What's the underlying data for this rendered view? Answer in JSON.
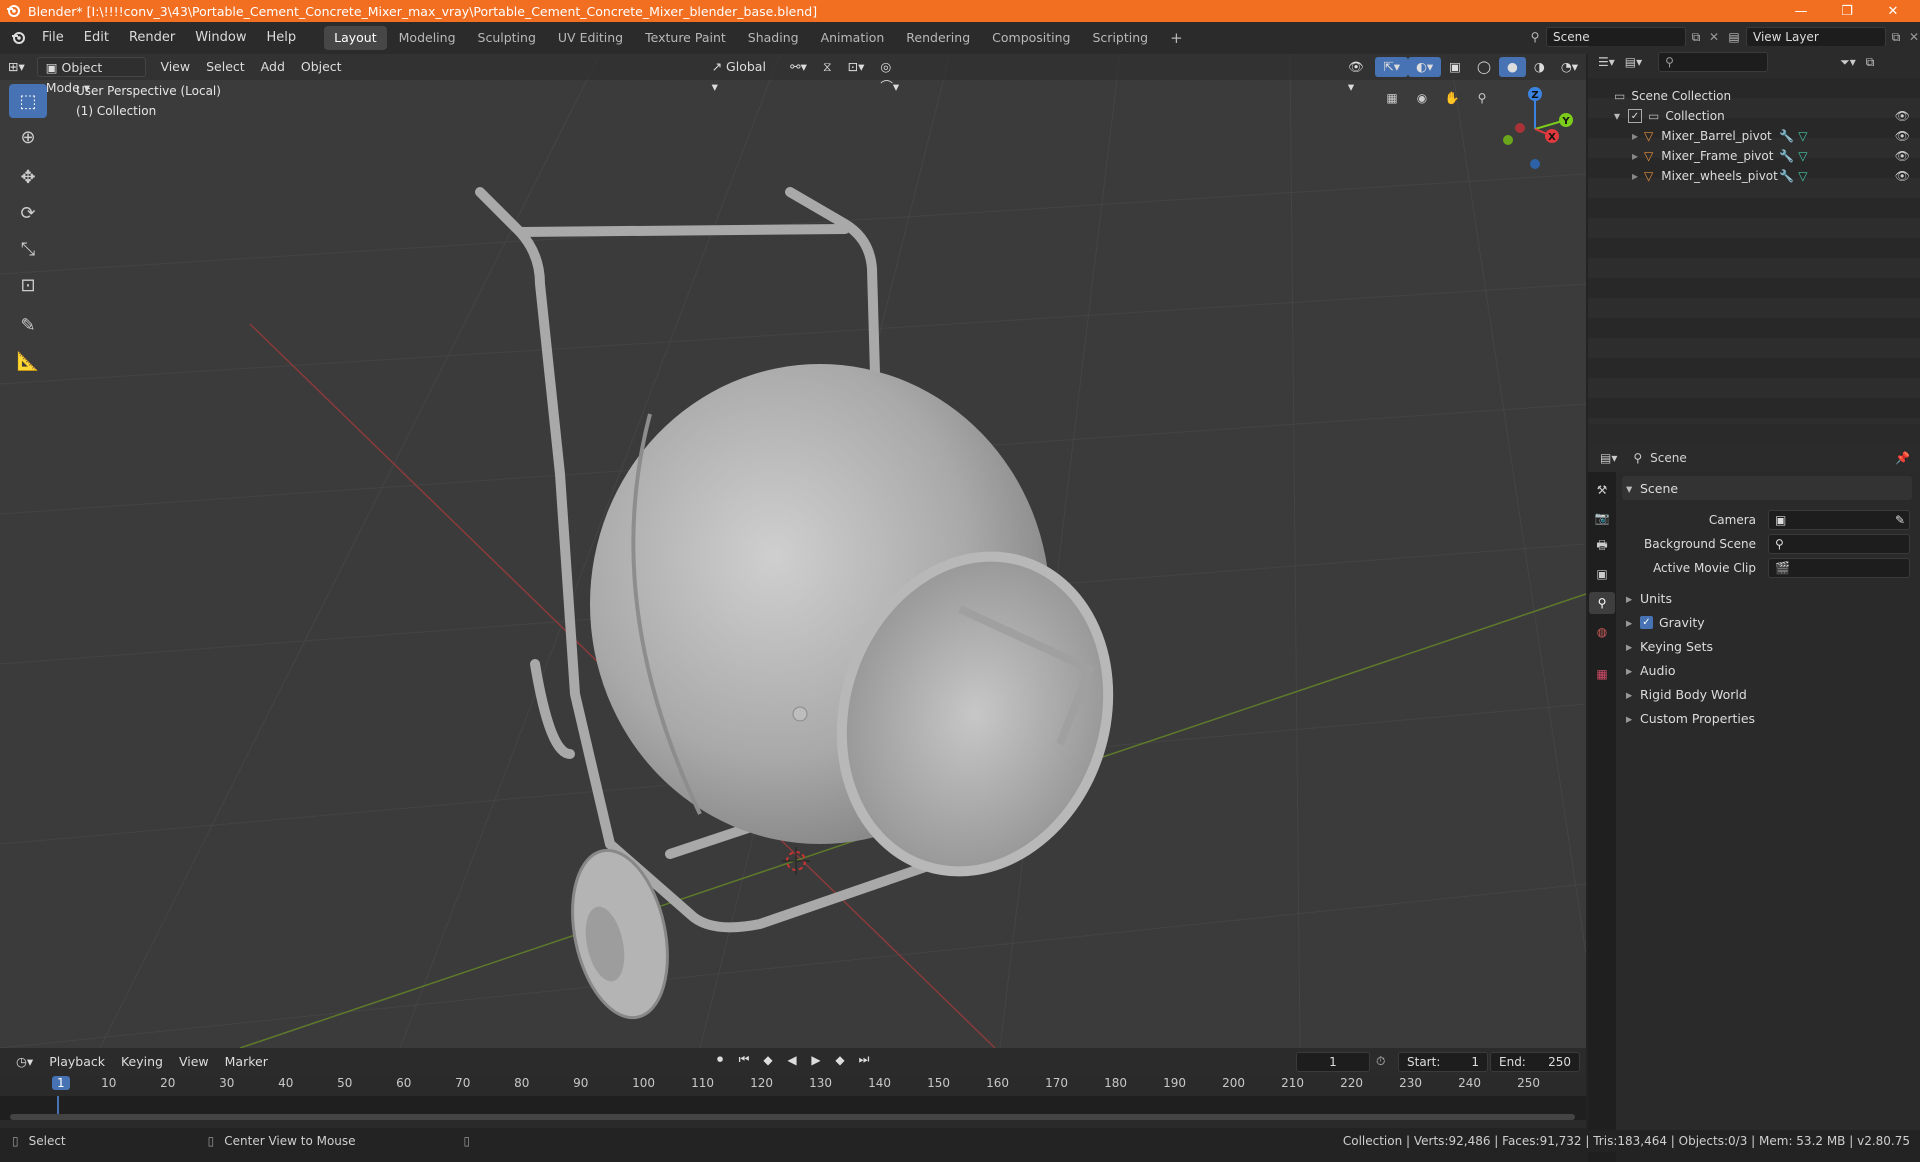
{
  "window": {
    "title": "Blender* [I:\\!!!!conv_3\\43\\Portable_Cement_Concrete_Mixer_max_vray\\Portable_Cement_Concrete_Mixer_blender_base.blend]",
    "min": "—",
    "max": "❐",
    "close": "✕"
  },
  "menu": [
    "File",
    "Edit",
    "Render",
    "Window",
    "Help"
  ],
  "workspaces": [
    "Layout",
    "Modeling",
    "Sculpting",
    "UV Editing",
    "Texture Paint",
    "Shading",
    "Animation",
    "Rendering",
    "Compositing",
    "Scripting"
  ],
  "active_workspace": "Layout",
  "scene_field": "Scene",
  "view_layer_field": "View Layer",
  "viewport": {
    "mode": "Object Mode",
    "menus": [
      "View",
      "Select",
      "Add",
      "Object"
    ],
    "transform_orientation": "Global",
    "overlay_line1": "User Perspective (Local)",
    "overlay_line2": "(1) Collection",
    "gizmo": {
      "z": "Z",
      "y": "Y",
      "x": "X"
    }
  },
  "outliner": {
    "root": "Scene Collection",
    "collection": "Collection",
    "items": [
      "Mixer_Barrel_pivot",
      "Mixer_Frame_pivot",
      "Mixer_wheels_pivot"
    ]
  },
  "properties": {
    "context": "Scene",
    "panel_title": "Scene",
    "fields": [
      {
        "label": "Camera",
        "value": ""
      },
      {
        "label": "Background Scene",
        "value": ""
      },
      {
        "label": "Active Movie Clip",
        "value": ""
      }
    ],
    "subpanels": [
      "Units",
      "Gravity",
      "Keying Sets",
      "Audio",
      "Rigid Body World",
      "Custom Properties"
    ],
    "gravity_checked": true
  },
  "timeline": {
    "menus": [
      "Playback",
      "Keying",
      "View",
      "Marker"
    ],
    "current_frame": "1",
    "start_label": "Start:",
    "start": "1",
    "end_label": "End:",
    "end": "250",
    "ticks": [
      "1",
      "10",
      "20",
      "30",
      "40",
      "50",
      "60",
      "70",
      "80",
      "90",
      "100",
      "110",
      "120",
      "130",
      "140",
      "150",
      "160",
      "170",
      "180",
      "190",
      "200",
      "210",
      "220",
      "230",
      "240",
      "250"
    ]
  },
  "status": {
    "left1": "Select",
    "left2": "Center View to Mouse",
    "right": "Collection | Verts:92,486 | Faces:91,732 | Tris:183,464 | Objects:0/3 | Mem: 53.2 MB | v2.80.75"
  },
  "colors": {
    "title_bar": "#f26f21",
    "active_tool": "#4772b3",
    "x_axis": "#e0393e",
    "y_axis": "#7ccc1c",
    "z_axis": "#3b83e0"
  }
}
